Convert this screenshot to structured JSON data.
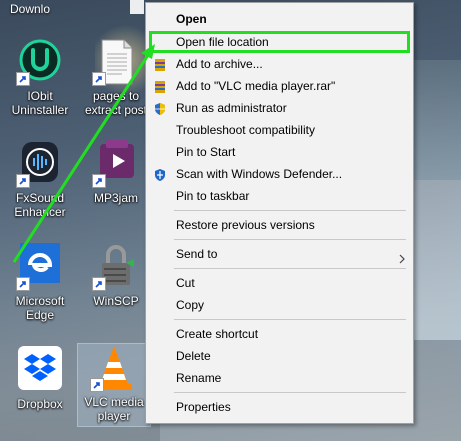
{
  "desktop": {
    "partial_top_label": "Downlo",
    "icons": [
      {
        "label": "IObit Uninstaller",
        "icon": "iobit-uninstaller-icon"
      },
      {
        "label": "pages to extract post",
        "icon": "document-icon"
      },
      {
        "label": "FxSound Enhancer",
        "icon": "fxsound-icon"
      },
      {
        "label": "MP3jam",
        "icon": "mp3jam-icon"
      },
      {
        "label": "Microsoft Edge",
        "icon": "edge-icon"
      },
      {
        "label": "WinSCP",
        "icon": "winscp-icon"
      },
      {
        "label": "Dropbox",
        "icon": "dropbox-icon"
      },
      {
        "label": "VLC media player",
        "icon": "vlc-icon"
      }
    ]
  },
  "context_menu": {
    "items": [
      {
        "label": "Open",
        "bold": true
      },
      {
        "label": "Open file location",
        "highlighted": true
      },
      {
        "label": "Add to archive...",
        "icon": "winrar-icon"
      },
      {
        "label": "Add to \"VLC media player.rar\"",
        "icon": "winrar-icon"
      },
      {
        "label": "Run as administrator",
        "icon": "uac-shield-icon"
      },
      {
        "label": "Troubleshoot compatibility"
      },
      {
        "label": "Pin to Start"
      },
      {
        "label": "Scan with Windows Defender...",
        "icon": "defender-icon"
      },
      {
        "label": "Pin to taskbar"
      },
      {
        "label": "Restore previous versions"
      },
      {
        "label": "Send to",
        "submenu": true
      },
      {
        "label": "Cut"
      },
      {
        "label": "Copy"
      },
      {
        "label": "Create shortcut"
      },
      {
        "label": "Delete"
      },
      {
        "label": "Rename"
      },
      {
        "label": "Properties"
      }
    ]
  },
  "colors": {
    "highlight": "#22dd22",
    "arrow": "#22dd22",
    "menu_bg": "#f2f2f2"
  }
}
